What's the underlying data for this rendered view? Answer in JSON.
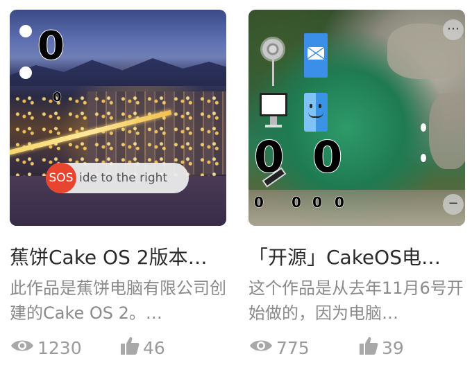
{
  "cards": [
    {
      "thumbnail": {
        "overlay_zero_large": "0",
        "overlay_zero_small": "0",
        "sos_label": "SOS",
        "slider_text": "ide to the right"
      },
      "title": "蕉饼Cake OS 2版本…",
      "description": "此作品是蕉饼电脑有限公司创建的Cake OS 2。…",
      "views": "1230",
      "likes": "46",
      "view_icon": "eye-icon",
      "like_icon": "thumbs-up-icon"
    },
    {
      "thumbnail": {
        "zero_left": "0",
        "zero_right": "0",
        "bottom_zeros": [
          "0",
          "0",
          "0",
          "0"
        ],
        "top_button": "⋯",
        "side_button": "−"
      },
      "title": "「开源」CakeOS电…",
      "description": "这个作品是从去年11月6号开始做的，因为电脑…",
      "views": "775",
      "likes": "39",
      "view_icon": "eye-icon",
      "like_icon": "thumbs-up-icon"
    }
  ],
  "colors": {
    "sos_red": "#e8442f",
    "stat_gray": "#9a9a9a",
    "title_text": "#2a2a2a",
    "desc_text": "#8a8a8a"
  }
}
